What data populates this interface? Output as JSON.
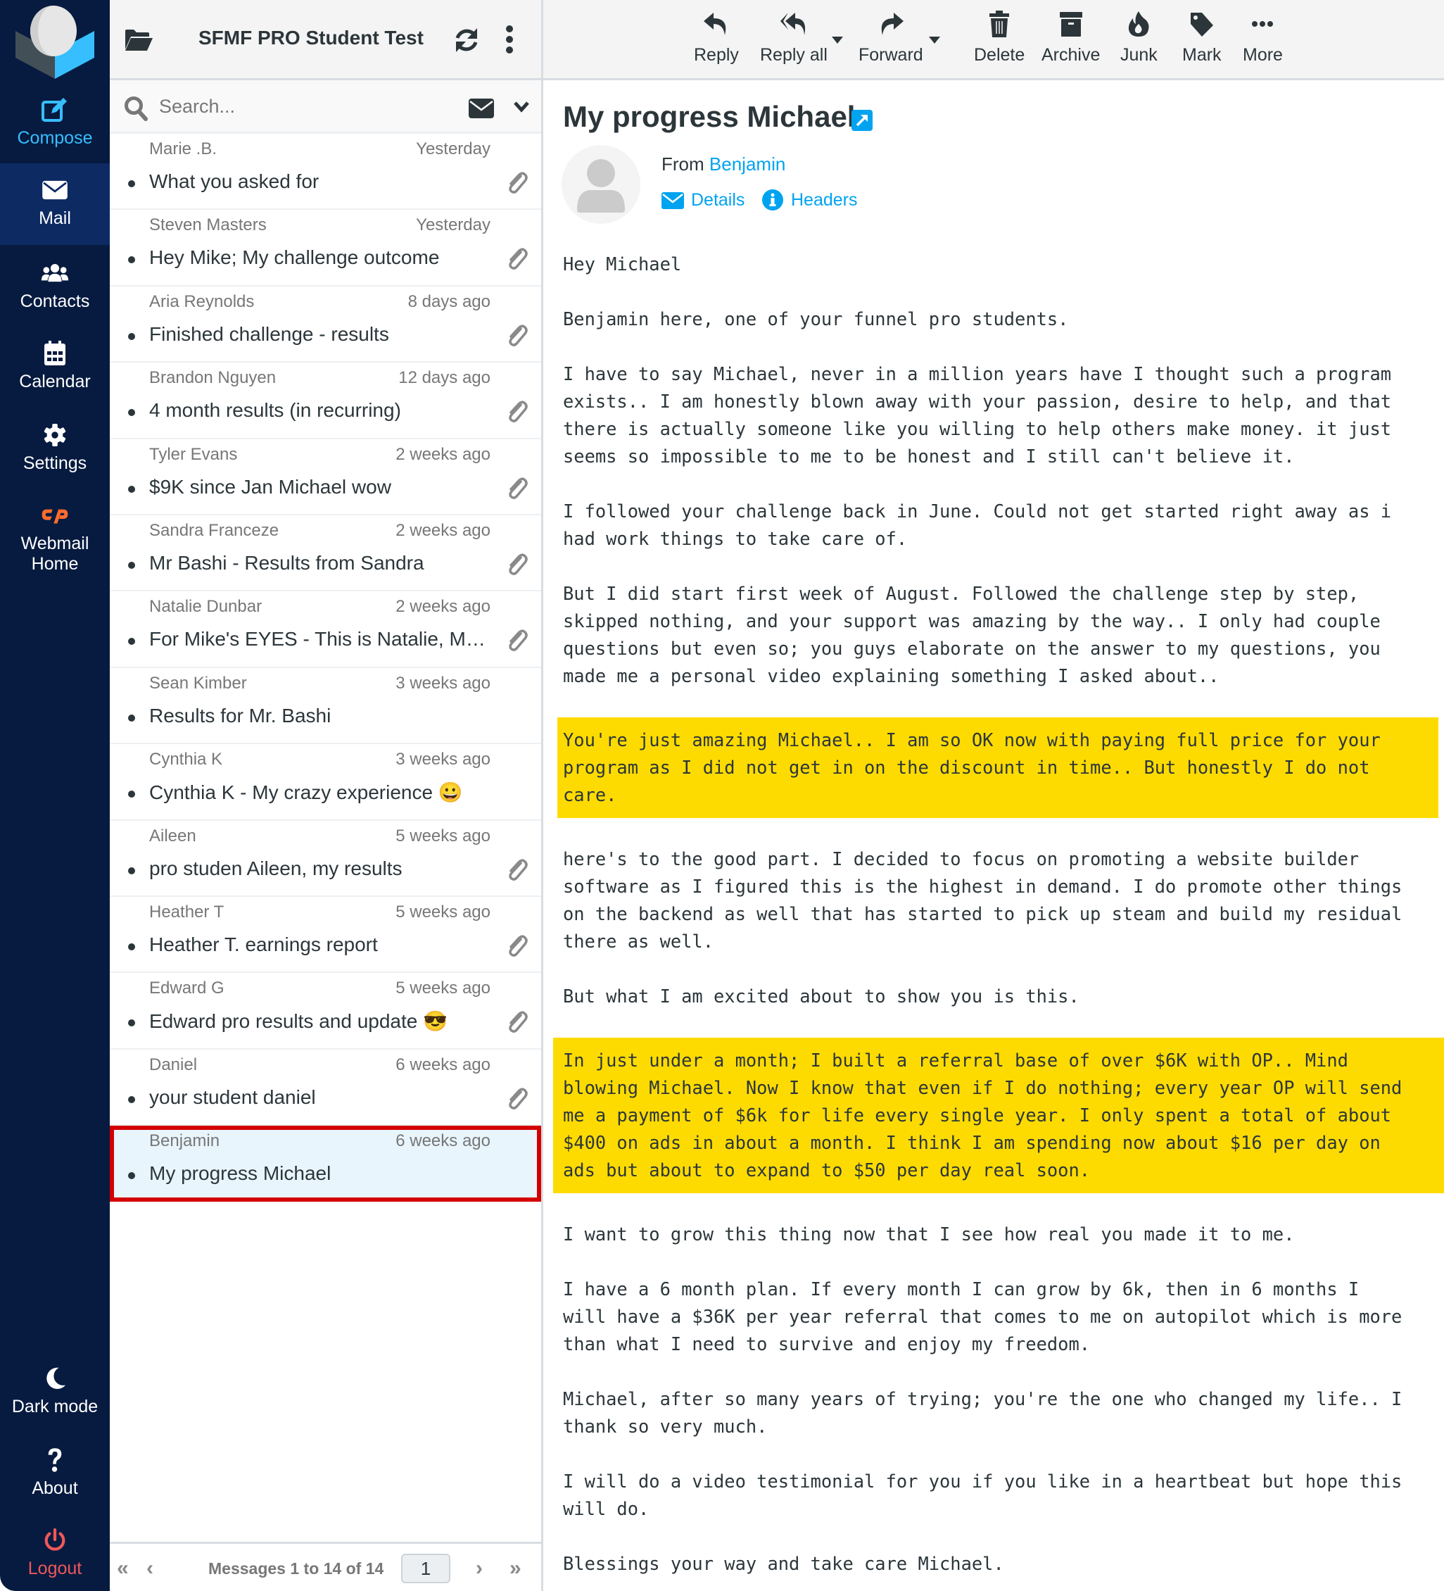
{
  "nav": {
    "items": [
      {
        "label": "Compose",
        "icon": "compose-icon"
      },
      {
        "label": "Mail",
        "icon": "mail-icon",
        "active": true
      },
      {
        "label": "Contacts",
        "icon": "contacts-icon"
      },
      {
        "label": "Calendar",
        "icon": "calendar-icon"
      },
      {
        "label": "Settings",
        "icon": "gear-icon"
      },
      {
        "label": "Webmail Home",
        "icon": "cpanel-icon"
      }
    ],
    "bottom": [
      {
        "label": "Dark mode",
        "icon": "moon-icon"
      },
      {
        "label": "About",
        "icon": "question-icon"
      },
      {
        "label": "Logout",
        "icon": "power-icon"
      }
    ],
    "colors": {
      "bg": "#071b40",
      "active": "#0d2a63",
      "accent": "#37beff",
      "logout": "#f0575a",
      "cpanel": "#ff6c2c"
    }
  },
  "list": {
    "folder_title": "SFMF PRO Student Testi...",
    "search_placeholder": "Search...",
    "messages": [
      {
        "from": "Marie .B.",
        "date": "Yesterday",
        "subject": "What you asked for",
        "attachment": true
      },
      {
        "from": "Steven Masters",
        "date": "Yesterday",
        "subject": "Hey Mike; My challenge outcome",
        "attachment": true
      },
      {
        "from": "Aria Reynolds",
        "date": "8 days ago",
        "subject": "Finished challenge - results",
        "attachment": true
      },
      {
        "from": "Brandon Nguyen",
        "date": "12 days ago",
        "subject": "4 month results (in recurring)",
        "attachment": true
      },
      {
        "from": "Tyler Evans",
        "date": "2 weeks ago",
        "subject": "$9K since Jan Michael wow",
        "attachment": true
      },
      {
        "from": "Sandra Franceze",
        "date": "2 weeks ago",
        "subject": "Mr Bashi - Results from Sandra",
        "attachment": true
      },
      {
        "from": "Natalie Dunbar",
        "date": "2 weeks ago",
        "subject": "For Mike's EYES - This is Natalie, My ...",
        "attachment": true
      },
      {
        "from": "Sean Kimber",
        "date": "3 weeks ago",
        "subject": "Results for Mr. Bashi",
        "attachment": false
      },
      {
        "from": "Cynthia K",
        "date": "3 weeks ago",
        "subject": "Cynthia K - My crazy experience 😀",
        "attachment": false
      },
      {
        "from": "Aileen",
        "date": "5 weeks ago",
        "subject": "pro studen Aileen, my results",
        "attachment": true
      },
      {
        "from": "Heather T",
        "date": "5 weeks ago",
        "subject": "Heather T. earnings report",
        "attachment": true
      },
      {
        "from": "Edward G",
        "date": "5 weeks ago",
        "subject": "Edward pro results and update 😎",
        "attachment": true
      },
      {
        "from": "Daniel",
        "date": "6 weeks ago",
        "subject": "your student daniel",
        "attachment": true
      },
      {
        "from": "Benjamin",
        "date": "6 weeks ago",
        "subject": "My progress Michael",
        "attachment": false,
        "selected": true
      }
    ],
    "footer": {
      "count_text": "Messages 1 to 14 of 14",
      "page": "1"
    }
  },
  "toolbar": {
    "buttons": [
      {
        "label": "Reply",
        "icon": "reply-icon"
      },
      {
        "label": "Reply all",
        "icon": "reply-all-icon",
        "dropdown": true
      },
      {
        "label": "Forward",
        "icon": "forward-icon",
        "dropdown": true
      },
      {
        "label": "Delete",
        "icon": "trash-icon"
      },
      {
        "label": "Archive",
        "icon": "archive-icon"
      },
      {
        "label": "Junk",
        "icon": "fire-icon"
      },
      {
        "label": "Mark",
        "icon": "tag-icon"
      },
      {
        "label": "More",
        "icon": "ellipsis-icon"
      }
    ]
  },
  "message": {
    "subject": "My progress Michael",
    "from_label": "From",
    "from_name": "Benjamin",
    "details_label": "Details",
    "headers_label": "Headers",
    "highlight_color": "#fedb00",
    "paragraphs": [
      {
        "text": "Hey Michael",
        "highlight": false
      },
      {
        "text": "Benjamin here, one of your funnel pro students.",
        "highlight": false
      },
      {
        "text": "I have to say Michael, never in a million years have I thought such a program\nexists.. I am honestly blown away with your passion, desire to help, and that\nthere is actually someone like you willing to help others make money. it just\nseems so impossible to me to be honest and I still can't believe it.",
        "highlight": false
      },
      {
        "text": "I followed your challenge back in June. Could not get started right away as i\nhad work things to take care of.",
        "highlight": false
      },
      {
        "text": "But I did start first week of August. Followed the challenge step by step,\nskipped nothing, and your support was amazing by the way.. I only had couple\nquestions but even so; you guys elaborate on the answer to my questions, you\nmade me a personal video explaining something I asked about..",
        "highlight": false
      },
      {
        "text": "You're just amazing Michael.. I am so OK now with paying full price for your\nprogram as I did not get in on the discount in time.. But honestly I do not\ncare.",
        "highlight": true
      },
      {
        "text": "here's to the good part. I decided to focus on promoting a website builder\nsoftware as I figured this is the highest in demand. I do promote other things\non the backend as well that has started to pick up steam and build my residual\nthere as well.",
        "highlight": false
      },
      {
        "text": "But what I am excited about to show you is this.",
        "highlight": false
      },
      {
        "text": "In just under a month; I built a referral base of over $6K with OP.. Mind\nblowing Michael. Now I know that even if I do nothing; every year OP will send\nme a payment of $6k for life every single year. I only spent a total of about\n$400 on ads in about a month. I think I am spending now about $16 per day on\nads but about to expand to $50 per day real soon.",
        "highlight": true
      },
      {
        "text": "I want to grow this thing now that I see how real you made it to me.",
        "highlight": false
      },
      {
        "text": "I have a 6 month plan. If every month I can grow by 6k, then in 6 months I\nwill have a $36K per year referral that comes to me on autopilot which is more\nthan what I need to survive and enjoy my freedom.",
        "highlight": false
      },
      {
        "text": "Michael, after so many years of trying; you're the one who changed my life.. I\nthank so very much.",
        "highlight": false
      },
      {
        "text": "I will do a video testimonial for you if you like in a heartbeat but hope this\nwill do.",
        "highlight": false
      },
      {
        "text": "Blessings your way and take care Michael.",
        "highlight": false
      }
    ]
  }
}
